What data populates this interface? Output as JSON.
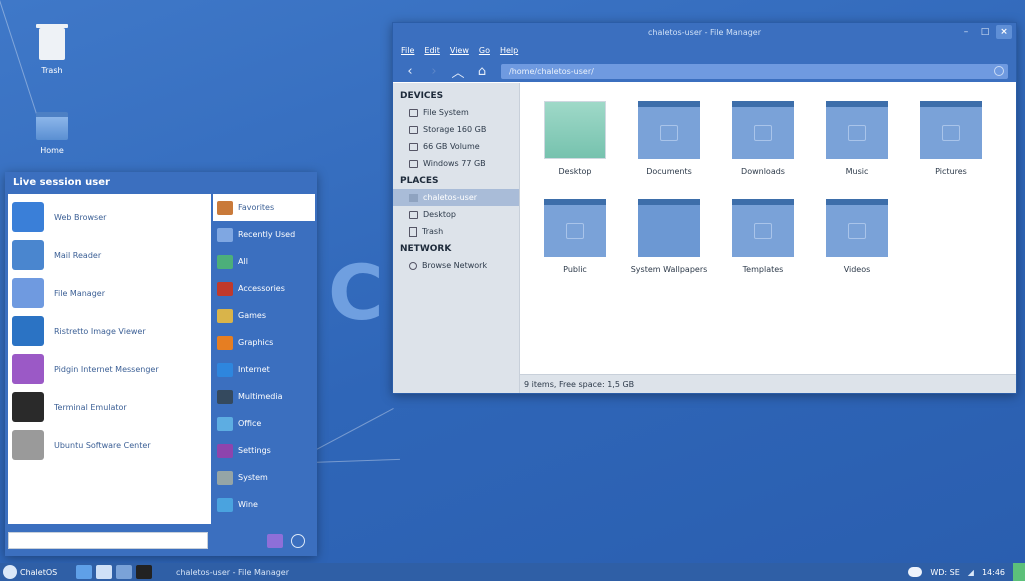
{
  "desktop": {
    "icons": [
      {
        "label": "Trash",
        "icon": "trash-icon"
      },
      {
        "label": "Home",
        "icon": "home-folder-icon"
      }
    ],
    "watermark": "C"
  },
  "file_manager": {
    "title": "chaletos-user - File Manager",
    "menu": [
      "File",
      "Edit",
      "View",
      "Go",
      "Help"
    ],
    "path": "/home/chaletos-user/",
    "sidebar": {
      "devices_header": "DEVICES",
      "devices": [
        "File System",
        "Storage 160 GB",
        "66 GB Volume",
        "Windows 77 GB"
      ],
      "places_header": "PLACES",
      "places": [
        "chaletos-user",
        "Desktop",
        "Trash"
      ],
      "network_header": "NETWORK",
      "network": [
        "Browse Network"
      ]
    },
    "items": [
      {
        "name": "Desktop",
        "icon": "desktop-thumbnail"
      },
      {
        "name": "Documents",
        "icon": "documents-folder-icon"
      },
      {
        "name": "Downloads",
        "icon": "downloads-folder-icon"
      },
      {
        "name": "Music",
        "icon": "music-folder-icon"
      },
      {
        "name": "Pictures",
        "icon": "pictures-folder-icon"
      },
      {
        "name": "Public",
        "icon": "public-folder-icon"
      },
      {
        "name": "System Wallpapers",
        "icon": "wallpapers-folder-icon"
      },
      {
        "name": "Templates",
        "icon": "templates-folder-icon"
      },
      {
        "name": "Videos",
        "icon": "videos-folder-icon"
      }
    ],
    "status": "9 items, Free space: 1,5 GB"
  },
  "start_menu": {
    "header": "Live session user",
    "apps": [
      {
        "label": "Web Browser",
        "icon": "web-browser-icon",
        "color": "#3a7fd8"
      },
      {
        "label": "Mail Reader",
        "icon": "mail-icon",
        "color": "#4a86cf"
      },
      {
        "label": "File Manager",
        "icon": "folder-icon",
        "color": "#6f9ae0"
      },
      {
        "label": "Ristretto Image Viewer",
        "icon": "image-viewer-icon",
        "color": "#2b73c4"
      },
      {
        "label": "Pidgin Internet Messenger",
        "icon": "pidgin-icon",
        "color": "#9b59c6"
      },
      {
        "label": "Terminal Emulator",
        "icon": "terminal-icon",
        "color": "#2a2a2a"
      },
      {
        "label": "Ubuntu Software Center",
        "icon": "software-center-icon",
        "color": "#9a9a9a"
      }
    ],
    "categories": [
      {
        "label": "Favorites",
        "icon": "favorites-icon",
        "color": "#c97a3a"
      },
      {
        "label": "Recently Used",
        "icon": "recent-icon",
        "color": "#7fa7e2"
      },
      {
        "label": "All",
        "icon": "all-apps-icon",
        "color": "#4caf7a"
      },
      {
        "label": "Accessories",
        "icon": "accessories-icon",
        "color": "#c0392b"
      },
      {
        "label": "Games",
        "icon": "games-icon",
        "color": "#d9b44a"
      },
      {
        "label": "Graphics",
        "icon": "graphics-icon",
        "color": "#e67e22"
      },
      {
        "label": "Internet",
        "icon": "internet-icon",
        "color": "#2e86de"
      },
      {
        "label": "Multimedia",
        "icon": "multimedia-icon",
        "color": "#34495e"
      },
      {
        "label": "Office",
        "icon": "office-icon",
        "color": "#5dade2"
      },
      {
        "label": "Settings",
        "icon": "settings-icon",
        "color": "#8e44ad"
      },
      {
        "label": "System",
        "icon": "system-icon",
        "color": "#95a5a6"
      },
      {
        "label": "Wine",
        "icon": "wine-icon",
        "color": "#4aa3df"
      }
    ],
    "search_placeholder": ""
  },
  "taskbar": {
    "start_label": "ChaletOS",
    "task": "chaletos-user - File Manager",
    "tray": {
      "weather": "WD: SE",
      "clock": "14:46"
    }
  }
}
